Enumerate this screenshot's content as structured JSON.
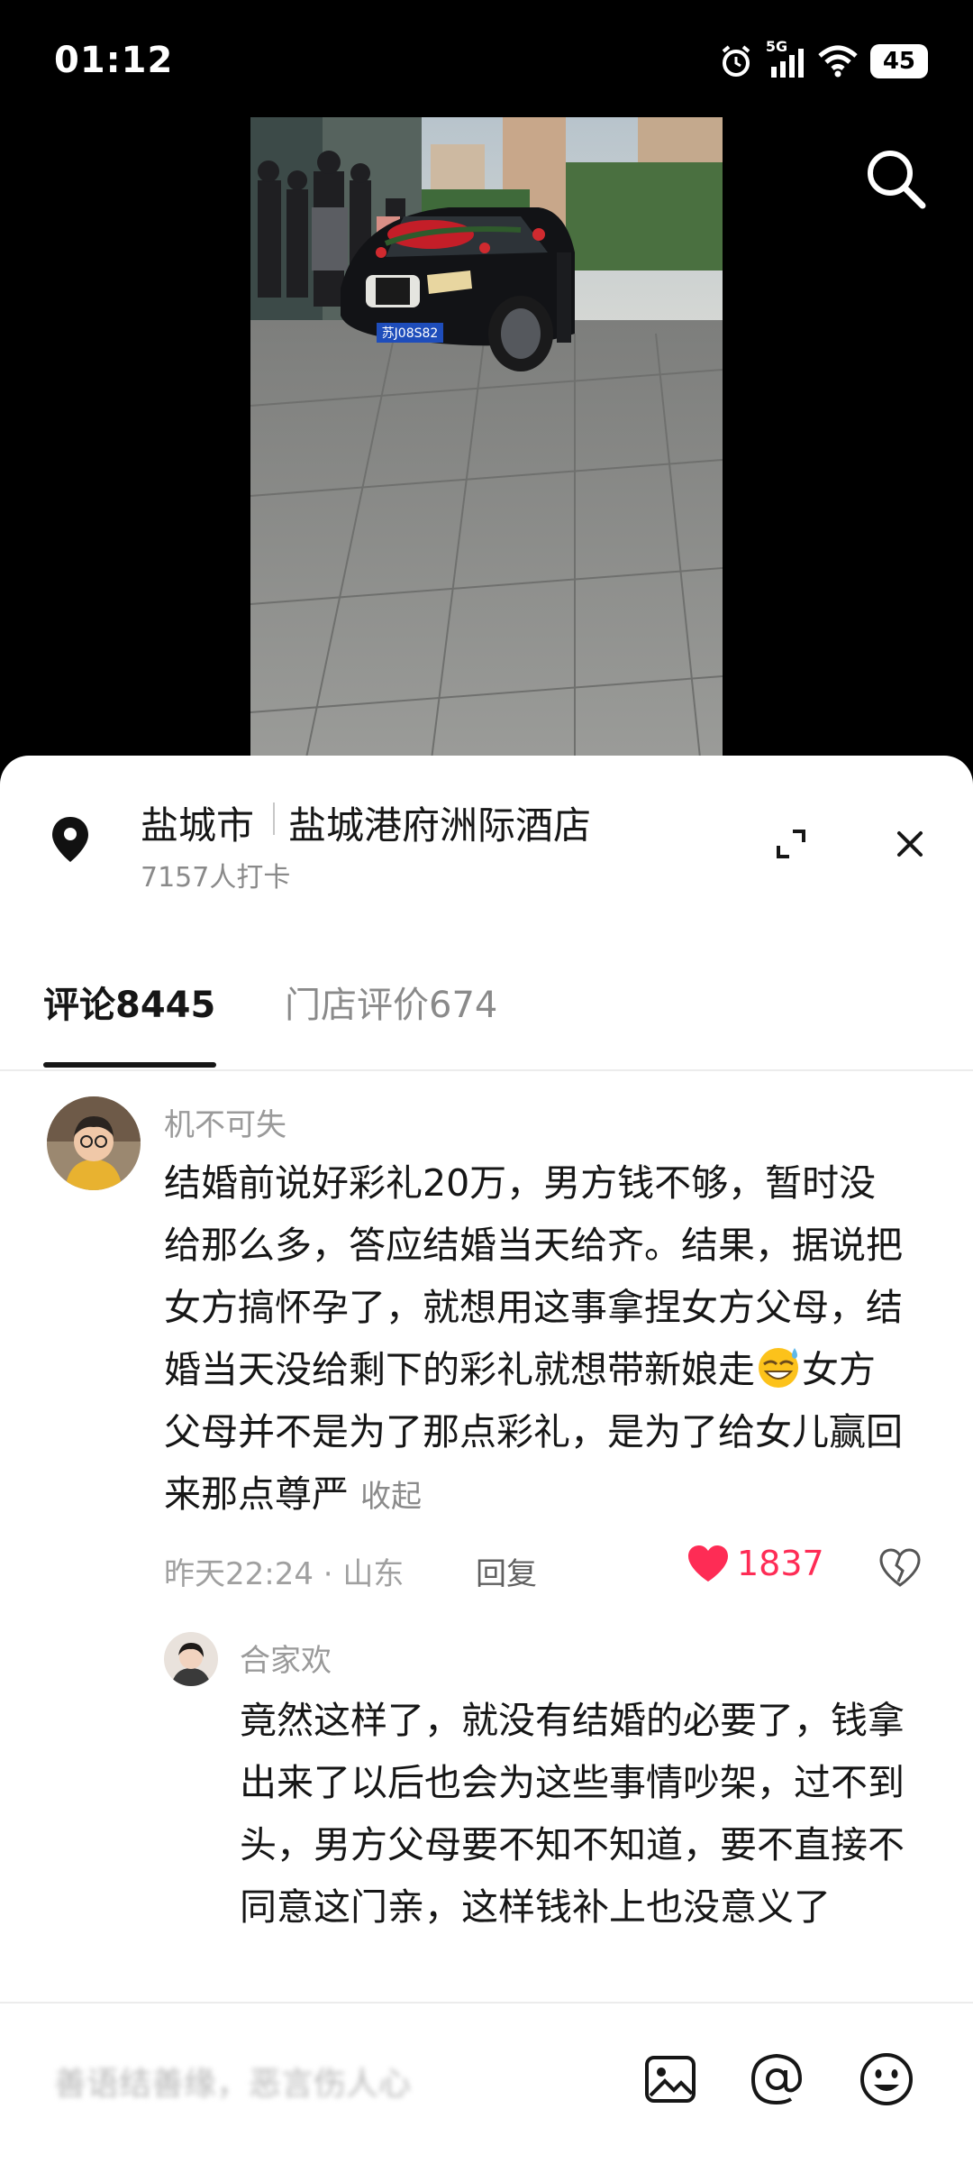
{
  "status_bar": {
    "time": "01:12",
    "network": "5G",
    "battery": "45"
  },
  "video": {
    "plate": "苏J08S82"
  },
  "location": {
    "city": "盐城市",
    "venue": "盐城港府洲际酒店",
    "checkins": "7157人打卡"
  },
  "tabs": [
    {
      "label": "评论8445",
      "active": true
    },
    {
      "label": "门店评价674",
      "active": false
    }
  ],
  "comment": {
    "user": "机不可失",
    "text_before_emoji": "结婚前说好彩礼20万，男方钱不够，暂时没给那么多，答应结婚当天给齐。结果，据说把女方搞怀孕了，就想用这事拿捏女方父母，结婚当天没给剩下的彩礼就想带新娘走",
    "text_after_emoji": "女方父母并不是为了那点彩礼，是为了给女儿赢回来那点尊严",
    "collapse_label": "收起",
    "meta": "昨天22:24 · 山东",
    "reply_label": "回复",
    "likes": "1837"
  },
  "reply": {
    "user": "合家欢",
    "text": "竟然这样了，就没有结婚的必要了，钱拿出来了以后也会为这些事情吵架，过不到头，男方父母要不知不知道，要不直接不同意这门亲，这样钱补上也没意义了"
  },
  "input_bar": {
    "placeholder": "善语结善缘，恶言伤人心"
  },
  "icons": {
    "search": "search-icon",
    "pin": "location-pin-icon",
    "expand": "expand-icon",
    "close": "close-icon",
    "heart": "heart-icon",
    "dislike": "broken-heart-icon",
    "image": "image-icon",
    "at": "at-icon",
    "emoji": "emoji-icon"
  },
  "colors": {
    "accent_like": "#fe2c55",
    "sheet_bg": "#ffffff",
    "text_primary": "#161616",
    "text_secondary": "#8a8a8a"
  }
}
